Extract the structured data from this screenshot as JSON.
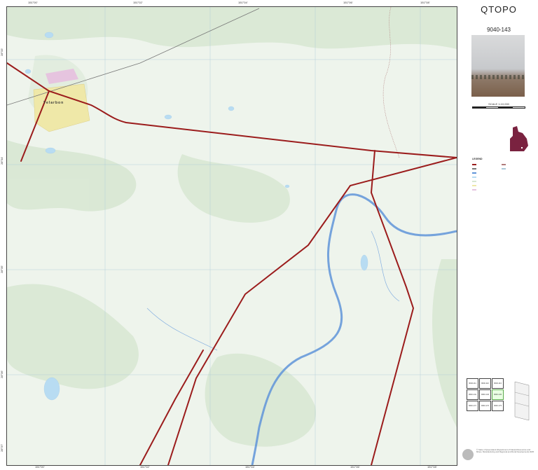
{
  "panel": {
    "brand": "QTOPO",
    "sheet_number": "9040-143",
    "scale": "SCALE 1:10,000"
  },
  "map": {
    "place_label": "Yelarbon",
    "top_coords": [
      "151°00'",
      "151°02'",
      "151°04'",
      "151°06'",
      "151°08'"
    ],
    "left_coords": [
      "28°33'",
      "28°34'",
      "28°35'",
      "28°36'",
      "28°37'"
    ],
    "bottom_coords": [
      "151°00'",
      "151°02'",
      "151°04'",
      "151°06'",
      "151°08'"
    ],
    "roads_color": "#9b1c1c",
    "water_color": "#b8dcf2",
    "river_color": "#5f94d9",
    "vegetation_color": "#d7e6d2"
  },
  "legend": {
    "heading": "LEGEND"
  },
  "index_map": {
    "cells": [
      "9040-111",
      "9040-112",
      "9040-113",
      "9040-141",
      "9040-142",
      "9040-143",
      "9040-171",
      "9040-172",
      "9040-173"
    ],
    "current": "9040-143"
  },
  "footer": {
    "copyright": "© State of Queensland (Department of Natural Resources and Mines, Manufacturing and Regional and Rural Development) 2025"
  }
}
